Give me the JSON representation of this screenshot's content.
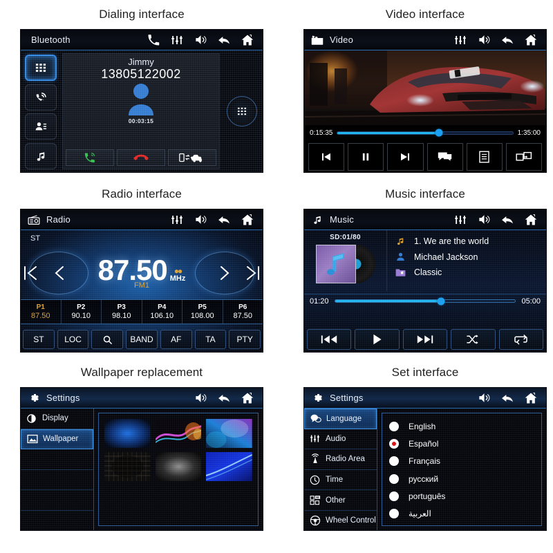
{
  "panels": {
    "dialing": {
      "caption": "Dialing interface",
      "header_title": "Bluetooth",
      "contact_name": "Jimmy",
      "phone_number": "13805122002",
      "call_duration": "00:03:15",
      "sidebar": [
        {
          "icon": "keypad-icon",
          "active": true
        },
        {
          "icon": "call-history-icon",
          "active": false
        },
        {
          "icon": "contacts-icon",
          "active": false
        },
        {
          "icon": "music-note-icon",
          "active": false
        }
      ],
      "actions": [
        {
          "icon": "answer-call-icon",
          "color": "#2fbd4a"
        },
        {
          "icon": "end-call-icon",
          "color": "#e02121"
        },
        {
          "icon": "transfer-audio-icon",
          "color": "#ffffff"
        }
      ],
      "header_icons": [
        "phone-icon",
        "equalizer-icon",
        "volume-icon",
        "back-icon",
        "home-icon"
      ]
    },
    "video": {
      "caption": "Video interface",
      "header_title": "Video",
      "elapsed": "0:15:35",
      "total": "1:35:00",
      "progress_pct": 58,
      "controls": [
        "previous-icon",
        "pause-icon",
        "next-icon",
        "subtitle-icon",
        "playlist-icon",
        "screen-share-icon"
      ],
      "header_icons": [
        "equalizer-icon",
        "volume-icon",
        "back-icon",
        "home-icon"
      ]
    },
    "radio": {
      "caption": "Radio interface",
      "header_title": "Radio",
      "stereo_label": "ST",
      "frequency": "87.50",
      "unit": "MHz",
      "band": "FM1",
      "presets": [
        {
          "name": "P1",
          "value": "87.50",
          "active": true
        },
        {
          "name": "P2",
          "value": "90.10",
          "active": false
        },
        {
          "name": "P3",
          "value": "98.10",
          "active": false
        },
        {
          "name": "P4",
          "value": "106.10",
          "active": false
        },
        {
          "name": "P5",
          "value": "108.00",
          "active": false
        },
        {
          "name": "P6",
          "value": "87.50",
          "active": false
        }
      ],
      "functions": [
        "ST",
        "LOC",
        "search-icon",
        "BAND",
        "AF",
        "TA",
        "PTY"
      ],
      "fn_labels": {
        "f0": "ST",
        "f1": "LOC",
        "f3": "BAND",
        "f4": "AF",
        "f5": "TA",
        "f6": "PTY"
      },
      "header_icons": [
        "equalizer-icon",
        "volume-icon",
        "back-icon",
        "home-icon"
      ]
    },
    "music": {
      "caption": "Music interface",
      "header_title": "Music",
      "source": "SD:01/80",
      "track_title": "1.  We are the world",
      "artist": "Michael Jackson",
      "genre": "Classic",
      "elapsed": "01:20",
      "total": "05:00",
      "progress_pct": 59,
      "controls": [
        "previous-track-icon",
        "play-icon",
        "next-track-icon",
        "shuffle-icon",
        "repeat-icon"
      ],
      "header_icons": [
        "equalizer-icon",
        "volume-icon",
        "back-icon",
        "home-icon"
      ]
    },
    "wallpaper": {
      "caption": "Wallpaper replacement",
      "header_title": "Settings",
      "sidebar": [
        {
          "label": "Display",
          "icon": "contrast-icon",
          "active": false
        },
        {
          "label": "Wallpaper",
          "icon": "image-icon",
          "active": true
        },
        {
          "label": "",
          "icon": "",
          "active": false
        },
        {
          "label": "",
          "icon": "",
          "active": false
        },
        {
          "label": "",
          "icon": "",
          "active": false
        },
        {
          "label": "",
          "icon": "",
          "active": false
        }
      ],
      "thumbs": [
        {
          "id": "wp-blue-glow",
          "selected": true
        },
        {
          "id": "wp-neon-wave",
          "selected": false
        },
        {
          "id": "wp-cyan-burst",
          "selected": false
        },
        {
          "id": "wp-dark-grid",
          "selected": false
        },
        {
          "id": "wp-gray-fog",
          "selected": false
        },
        {
          "id": "wp-blue-curve",
          "selected": false
        }
      ],
      "checkmark": "✔",
      "header_icons": [
        "volume-icon",
        "back-icon",
        "home-icon"
      ]
    },
    "settings": {
      "caption": "Set interface",
      "header_title": "Settings",
      "sidebar": [
        {
          "label": "Language",
          "icon": "speech-bubble-icon",
          "active": true
        },
        {
          "label": "Audio",
          "icon": "equalizer-icon",
          "active": false
        },
        {
          "label": "Radio Area",
          "icon": "antenna-icon",
          "active": false
        },
        {
          "label": "Time",
          "icon": "clock-icon",
          "active": false
        },
        {
          "label": "Other",
          "icon": "grid-apps-icon",
          "active": false
        },
        {
          "label": "Wheel Control",
          "icon": "steering-wheel-icon",
          "active": false
        }
      ],
      "languages": [
        {
          "label": "English",
          "selected": false
        },
        {
          "label": "Español",
          "selected": true
        },
        {
          "label": "Français",
          "selected": false
        },
        {
          "label": "русский",
          "selected": false
        },
        {
          "label": "português",
          "selected": false
        },
        {
          "label": "العربية",
          "selected": false
        }
      ],
      "header_icons": [
        "volume-icon",
        "back-icon",
        "home-icon"
      ]
    }
  },
  "colors": {
    "accent_blue": "#2f86e0",
    "progress_cyan": "#1fb6f0",
    "preset_gold": "#d9a23c",
    "radio_red": "#d81111",
    "call_green": "#2fbd4a",
    "call_red": "#e02121"
  }
}
